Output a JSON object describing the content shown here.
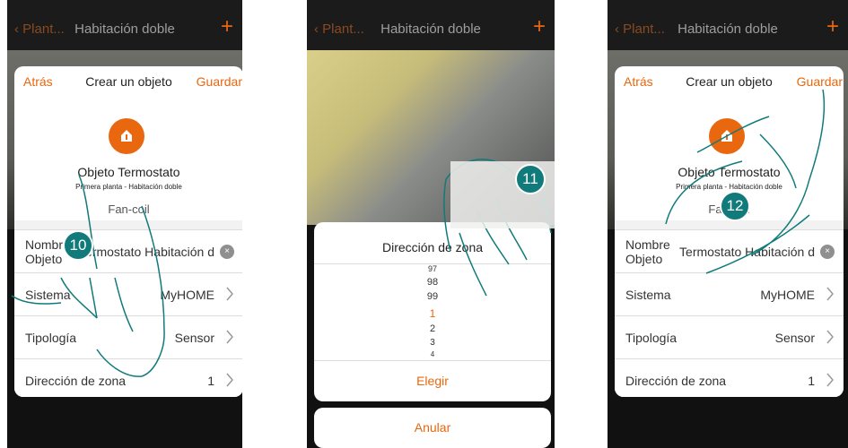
{
  "topbar": {
    "back_label": "Plant...",
    "title": "Habitación doble",
    "plus": "+"
  },
  "form": {
    "back": "Atrás",
    "title": "Crear un objeto",
    "save": "Guardar",
    "object_name": "Objeto Termostato",
    "object_sub": "Primera planta - Habitación doble",
    "object_type": "Fan-coil",
    "rows": {
      "name_label": "Nombre Objeto",
      "name_value": "Termostato Habitación d",
      "system_label": "Sistema",
      "system_value": "MyHOME",
      "type_label": "Tipología",
      "type_value": "Sensor",
      "zone_label": "Dirección de zona",
      "zone_value": "1"
    }
  },
  "picker": {
    "title": "Dirección de zona",
    "numbers": [
      "97",
      "98",
      "99",
      "1",
      "2",
      "3",
      "4"
    ],
    "selected": "1",
    "choose": "Elegir",
    "cancel": "Anular"
  },
  "steps": [
    "10",
    "11",
    "12"
  ],
  "colors": {
    "accent": "#e8670f",
    "badge": "#117a7a"
  }
}
